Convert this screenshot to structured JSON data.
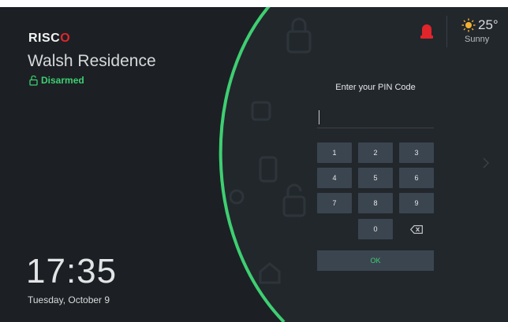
{
  "brand": {
    "text": "RISC",
    "mark": "O"
  },
  "residence": "Walsh Residence",
  "status": {
    "label": "Disarmed",
    "icon": "unlock-icon",
    "color": "#3ecf72"
  },
  "time": "17:35",
  "date": "Tuesday, October 9",
  "alarm": {
    "icon": "siren-icon",
    "color": "#e0252b"
  },
  "weather": {
    "icon": "sun-icon",
    "temperature": "25°",
    "condition": "Sunny",
    "icon_color": "#f2b134"
  },
  "keypad": {
    "title": "Enter your PIN Code",
    "keys": [
      "1",
      "2",
      "3",
      "4",
      "5",
      "6",
      "7",
      "8",
      "9",
      "0"
    ],
    "backspace_icon": "backspace-icon",
    "ok_label": "OK"
  },
  "colors": {
    "accent_green": "#3ecf72",
    "background": "#1c2024",
    "key": "#3b4550"
  }
}
